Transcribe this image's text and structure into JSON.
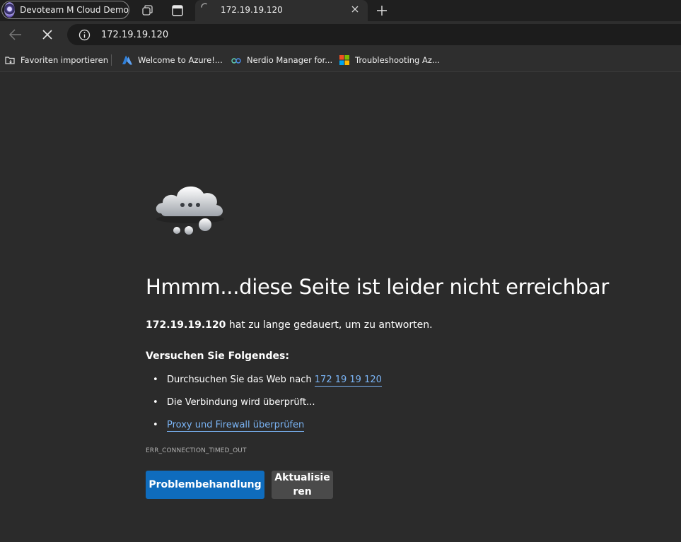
{
  "profile": {
    "name": "Devoteam M Cloud Demo"
  },
  "tab": {
    "title": "172.19.19.120"
  },
  "address_bar": {
    "url": "172.19.19.120"
  },
  "favorites": [
    {
      "label": "Favoriten importieren",
      "icon": "import-favorites-icon"
    },
    {
      "label": "Welcome to Azure!...",
      "icon": "azure-icon"
    },
    {
      "label": "Nerdio Manager for...",
      "icon": "nerdio-icon"
    },
    {
      "label": "Troubleshooting Az...",
      "icon": "microsoft-icon"
    }
  ],
  "error_page": {
    "headline": "Hmmm...diese Seite ist leider nicht erreichbar",
    "host": "172.19.19.120",
    "message": " hat zu lange gedauert, um zu antworten.",
    "try_title": "Versuchen Sie Folgendes:",
    "suggestions": {
      "search_prefix": "Durchsuchen Sie das Web nach ",
      "search_link": "172 19 19 120",
      "checking": "Die Verbindung wird überprüft...",
      "proxy_link": "Proxy und Firewall überprüfen"
    },
    "error_code": "ERR_CONNECTION_TIMED_OUT",
    "troubleshoot_button": "Problembehandlung",
    "refresh_button": "Aktualisieren"
  }
}
